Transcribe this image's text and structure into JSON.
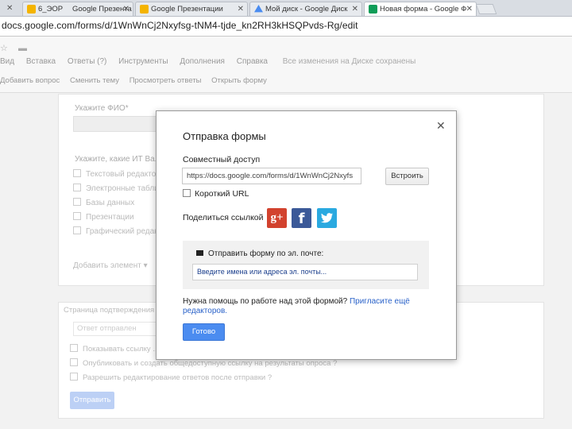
{
  "browser": {
    "tabs": [
      {
        "title": "6_ЭОР",
        "icon": "google-slides-icon",
        "color": "#f4b400"
      },
      {
        "title": "Google Презента",
        "icon": "google-slides-icon",
        "color": "#f4b400"
      },
      {
        "title": "Google Презентации",
        "icon": "google-slides-icon",
        "color": "#f4b400"
      },
      {
        "title": "Мой диск - Google Диск",
        "icon": "google-drive-icon",
        "color": "#4a8cf0"
      },
      {
        "title": "Новая форма - Google Ф",
        "icon": "google-forms-icon",
        "color": "#0f9d58",
        "active": true
      }
    ],
    "url": "docs.google.com/forms/d/1WnWnCj2Nxyfsg-tNM4-tjde_kn2RH3kHSQPvds-Rg/edit"
  },
  "docs": {
    "menu": [
      "Вид",
      "Вставка",
      "Ответы (?)",
      "Инструменты",
      "Дополнения",
      "Справка"
    ],
    "saved_status": "Все изменения на Диске сохранены",
    "toolbar": [
      "Добавить вопрос",
      "Сменить тему",
      "Просмотреть ответы",
      "Открыть форму"
    ]
  },
  "form": {
    "q1_label": "Укажите ФИО*",
    "q2_label": "Укажите, какие ИТ Ва...",
    "q2_options": [
      "Текстовый редактор",
      "Электронные табли...",
      "Базы данных",
      "Презентации",
      "Графический редак..."
    ],
    "add_item": "Добавить элемент",
    "confirmation_title": "Страница подтверждения",
    "confirmation_placeholder": "Ответ отправлен",
    "conf_opts": [
      "Показывать ссылку ...",
      "Опубликовать и создать общедоступную ссылку на результаты опроса ?",
      "Разрешить редактирование ответов после отправки ?"
    ],
    "send_label": "Отправить"
  },
  "dialog": {
    "title": "Отправка формы",
    "share_label": "Совместный доступ",
    "link": "https://docs.google.com/forms/d/1WnWnCj2Nxyfs",
    "embed_label": "Встроить",
    "short_url_label": "Короткий URL",
    "short_url_checked": false,
    "share_link_label": "Поделиться ссылкой",
    "social": [
      {
        "name": "google-plus-icon",
        "glyph": "g+"
      },
      {
        "name": "facebook-icon",
        "glyph": "f"
      },
      {
        "name": "twitter-icon",
        "glyph": "🐦"
      }
    ],
    "email_label": "Отправить форму по эл. почте:",
    "email_placeholder": "Введите имена или адреса эл. почты...",
    "help_text": "Нужна помощь по работе над этой формой?",
    "help_link": "Пригласите ещё редакторов.",
    "done_label": "Готово"
  },
  "colors": {
    "primary_button": "#4b8cf0",
    "link": "#2a62c9",
    "google_plus": "#d2422e",
    "facebook": "#3b5998",
    "twitter": "#2aa9e0"
  }
}
